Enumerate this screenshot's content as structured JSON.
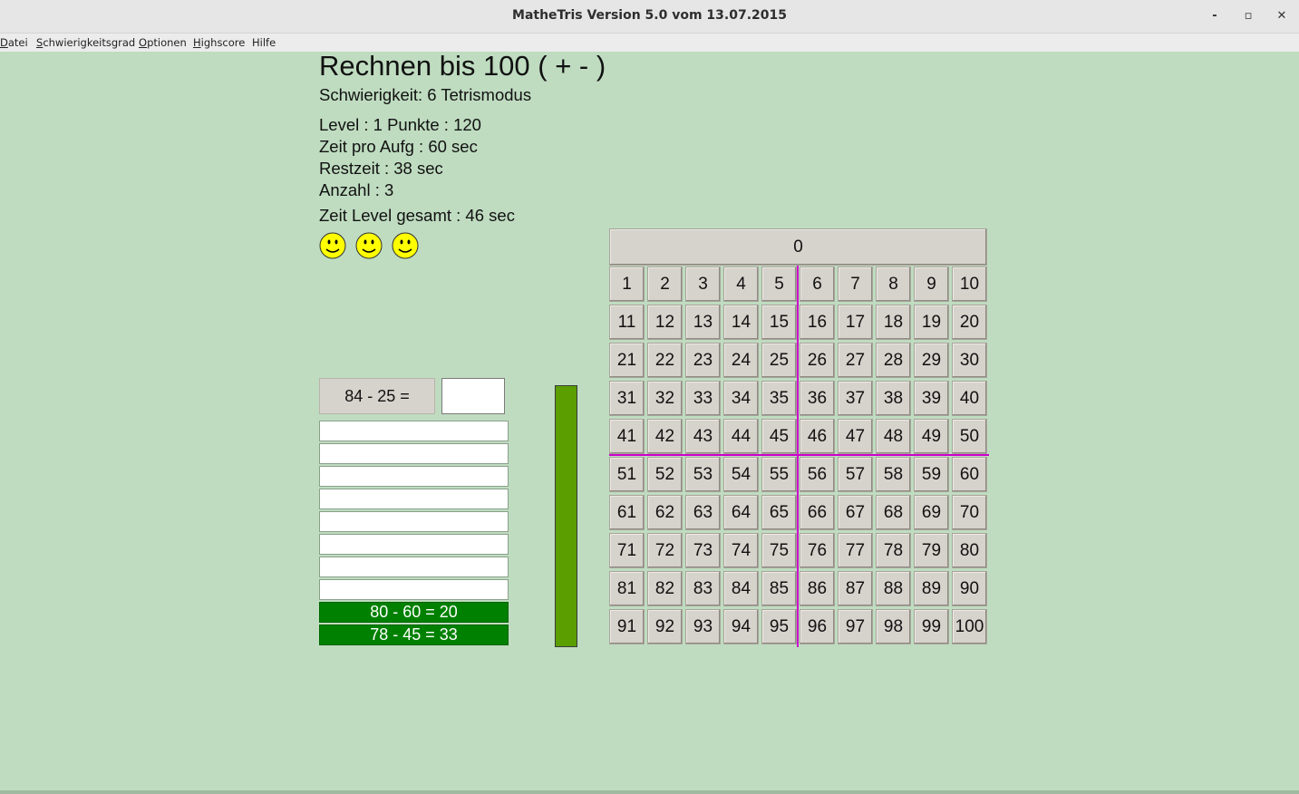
{
  "window": {
    "title": "MatheTris Version 5.0 vom 13.07.2015",
    "minimize_label": "-",
    "maximize_label": "▫",
    "close_label": "✕"
  },
  "menu": [
    {
      "label": "Datei",
      "accel": "D",
      "rest": "atei"
    },
    {
      "label": "Schwierigkeitsgrad",
      "accel": "S",
      "rest": "chwierigkeitsgrad"
    },
    {
      "label": "Optionen",
      "accel": "O",
      "rest": "ptionen"
    },
    {
      "label": "Highscore",
      "accel": "H",
      "rest": "ighscore"
    },
    {
      "label": "Hilfe",
      "accel": "",
      "rest": "Hilfe"
    }
  ],
  "header": {
    "title": "Rechnen bis 100 ( + - )",
    "difficulty": "Schwierigkeit: 6 Tetrismodus"
  },
  "stats": {
    "level_points": "Level : 1 Punkte : 120",
    "time_per_task": "Zeit pro Aufg : 60 sec",
    "remaining": "Restzeit : 38 sec",
    "count": "Anzahl : 3",
    "level_total": "Zeit Level gesamt : 46 sec"
  },
  "lives": 3,
  "task": {
    "expression": "84 - 25 =",
    "answer": ""
  },
  "empty_slots": 8,
  "solved": [
    "80 - 60 = 20",
    "78 - 45 = 33"
  ],
  "time_fraction": 1.0,
  "colors": {
    "background": "#bfdcc0",
    "solved": "#008000",
    "timebar": "#5a9e00",
    "divider": "#cc00cc",
    "smiley": "#ffff00"
  },
  "grid": {
    "display_value": "0",
    "numbers": [
      1,
      2,
      3,
      4,
      5,
      6,
      7,
      8,
      9,
      10,
      11,
      12,
      13,
      14,
      15,
      16,
      17,
      18,
      19,
      20,
      21,
      22,
      23,
      24,
      25,
      26,
      27,
      28,
      29,
      30,
      31,
      32,
      33,
      34,
      35,
      36,
      37,
      38,
      39,
      40,
      41,
      42,
      43,
      44,
      45,
      46,
      47,
      48,
      49,
      50,
      51,
      52,
      53,
      54,
      55,
      56,
      57,
      58,
      59,
      60,
      61,
      62,
      63,
      64,
      65,
      66,
      67,
      68,
      69,
      70,
      71,
      72,
      73,
      74,
      75,
      76,
      77,
      78,
      79,
      80,
      81,
      82,
      83,
      84,
      85,
      86,
      87,
      88,
      89,
      90,
      91,
      92,
      93,
      94,
      95,
      96,
      97,
      98,
      99,
      100
    ]
  }
}
